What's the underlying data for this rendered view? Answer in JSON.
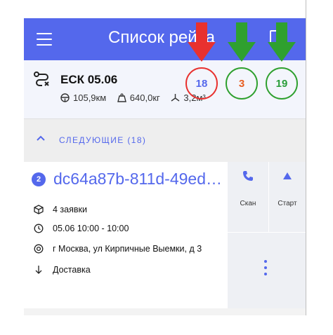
{
  "appbar": {
    "title": "Список рейса",
    "menu_icon": "hamburger-menu-icon",
    "page_icon": "document-icon"
  },
  "summary": {
    "route_icon": "route-icon",
    "title": "ЕСК 05.06",
    "distance": "105,9км",
    "weight": "640,0кг",
    "volume": "3,2м³",
    "counters": [
      {
        "value": "18",
        "color": "#5468ec"
      },
      {
        "value": "3",
        "color": "#e85d20"
      },
      {
        "value": "19",
        "color": "#2a9d3a"
      }
    ]
  },
  "section": {
    "label": "СЛЕДУЮЩИЕ (18)"
  },
  "delivery": {
    "badge": "2",
    "id": "dc64a87b-811d-49ed…",
    "orders": "4 заявки",
    "time": "05.06 10:00 - 10:00",
    "address": "г Москва, ул Кирпичные Выемки, д 3",
    "type": "Доставка"
  },
  "actions": {
    "scan_label": "Скан",
    "start_label": "Старт"
  },
  "colors": {
    "primary": "#5468ec",
    "annotation_red": "#e8312f",
    "annotation_green": "#2fa02f"
  }
}
